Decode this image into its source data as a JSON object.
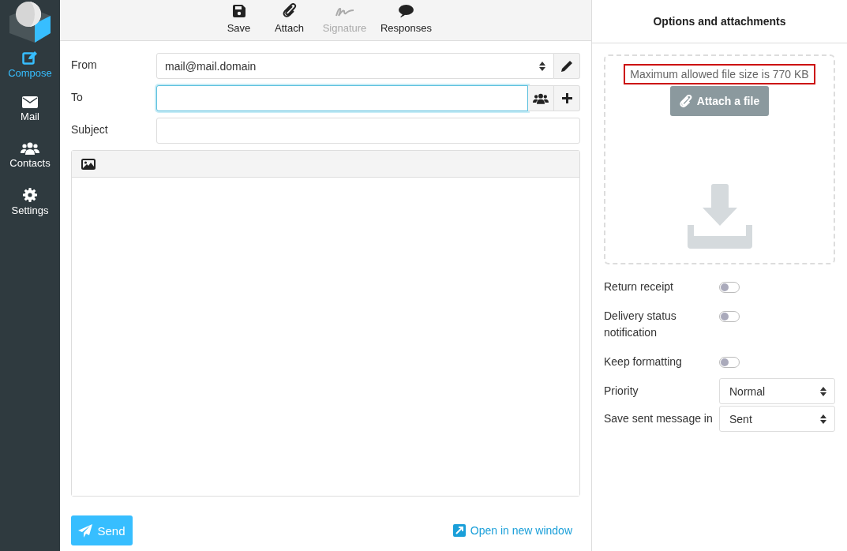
{
  "sidebar": {
    "items": [
      {
        "label": "Compose",
        "kind": "compose",
        "selected": true
      },
      {
        "label": "Mail",
        "kind": "mail",
        "selected": false
      },
      {
        "label": "Contacts",
        "kind": "contacts",
        "selected": false
      },
      {
        "label": "Settings",
        "kind": "settings",
        "selected": false
      }
    ]
  },
  "toolbar": [
    {
      "label": "Save",
      "kind": "save",
      "disabled": false
    },
    {
      "label": "Attach",
      "kind": "attach",
      "disabled": false
    },
    {
      "label": "Signature",
      "kind": "signature",
      "disabled": true
    },
    {
      "label": "Responses",
      "kind": "responses",
      "disabled": false
    }
  ],
  "form": {
    "from": {
      "label": "From",
      "value": "mail@mail.domain"
    },
    "to": {
      "label": "To",
      "focused": true
    },
    "subject": {
      "label": "Subject"
    }
  },
  "send_button": "Send",
  "open_new_window": "Open in new window",
  "options": {
    "title": "Options and attachments",
    "size_hint": "Maximum allowed file size is 770 KB",
    "attach_button": "Attach a file",
    "toggles": [
      {
        "label": "Return receipt",
        "on": false
      },
      {
        "label": "Delivery status notification",
        "on": false
      },
      {
        "label": "Keep formatting",
        "on": false
      }
    ],
    "selects": [
      {
        "label": "Priority",
        "value": "Normal"
      },
      {
        "label": "Save sent message in",
        "value": "Sent"
      }
    ]
  }
}
